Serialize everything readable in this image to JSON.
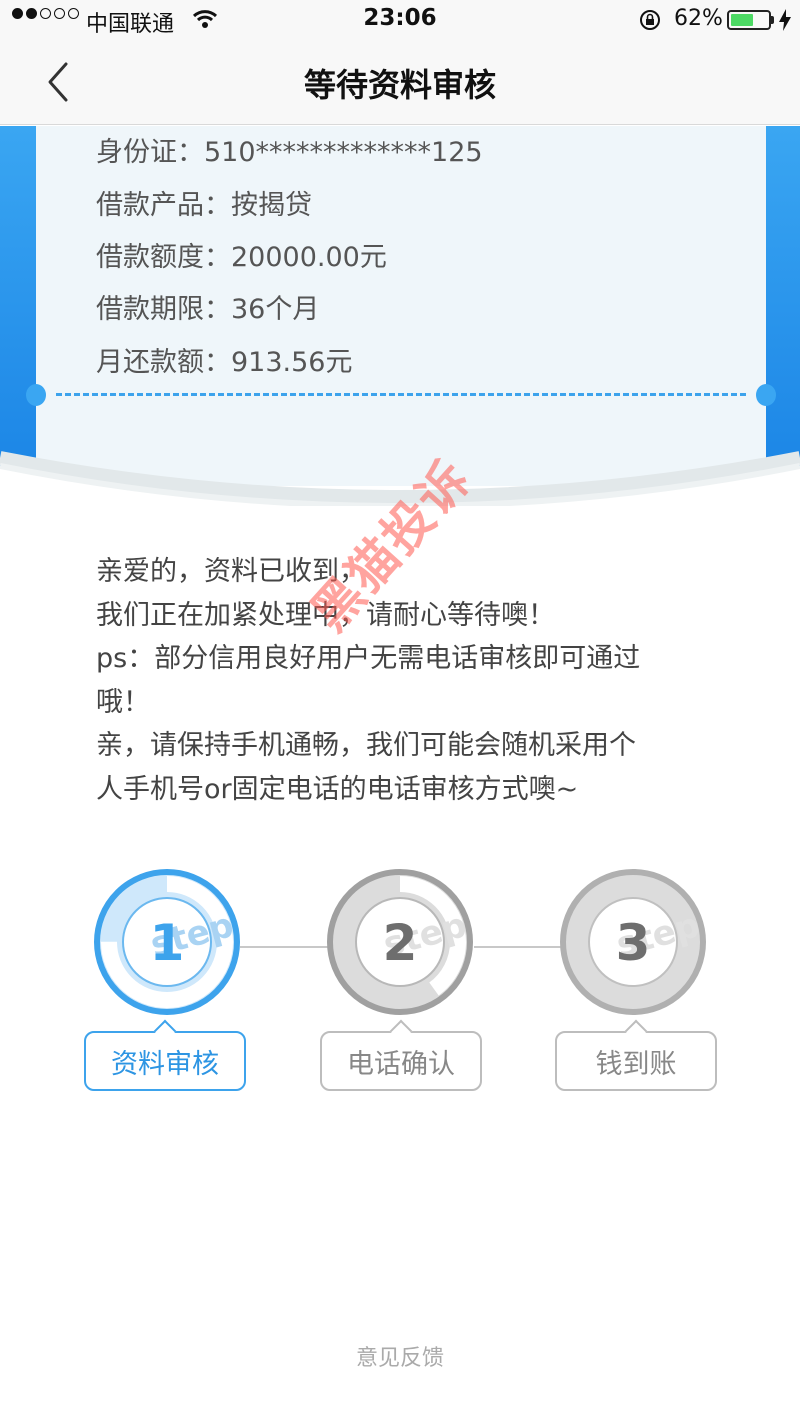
{
  "status_bar": {
    "carrier": "中国联通",
    "time": "23:06",
    "battery_percent": "62%",
    "battery_level": 0.62,
    "signal_bars": 2
  },
  "nav": {
    "title": "等待资料审核",
    "back_icon": "chevron-left-icon"
  },
  "loan_info": [
    {
      "label": "身份证：",
      "value": "510*************125"
    },
    {
      "label": "借款产品：",
      "value": "按揭贷"
    },
    {
      "label": "借款额度：",
      "value": "20000.00元"
    },
    {
      "label": "借款期限：",
      "value": "36个月"
    },
    {
      "label": "月还款额：",
      "value": "913.56元"
    }
  ],
  "message": {
    "lines": [
      "亲爱的，资料已收到，",
      "我们正在加紧处理中，请耐心等待噢！",
      "ps：部分信用良好用户无需电话审核即可通过",
      "哦！",
      "亲，请保持手机通畅，我们可能会随机采用个",
      "人手机号or固定电话的电话审核方式噢~"
    ]
  },
  "watermark": "黑猫投诉",
  "steps": [
    {
      "number": "1",
      "label": "资料审核",
      "active": true,
      "progress": 0.75,
      "badge": "step"
    },
    {
      "number": "2",
      "label": "电话确认",
      "active": false,
      "progress": 0.4,
      "badge": "step"
    },
    {
      "number": "3",
      "label": "钱到账",
      "active": false,
      "progress": 0,
      "badge": "step"
    }
  ],
  "colors": {
    "primary_blue": "#3da3ec",
    "inactive_gray": "#a0a0a0",
    "ticket_bg": "#eff6fa"
  },
  "footer": {
    "feedback_label": "意见反馈"
  }
}
